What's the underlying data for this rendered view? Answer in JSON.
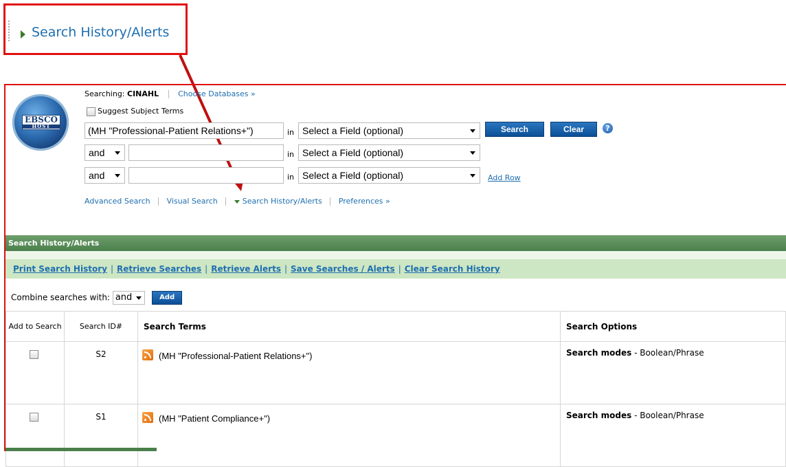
{
  "callout": {
    "label": "Search History/Alerts"
  },
  "logo": {
    "line1": "EBSCO",
    "line2": "HOST"
  },
  "header": {
    "searching_label": "Searching:",
    "database": "CINAHL",
    "choose_db": "Choose Databases »",
    "suggest_terms": "Suggest Subject Terms"
  },
  "search": {
    "row1_value": "(MH \"Professional-Patient Relations+\")",
    "row2_value": "",
    "row3_value": "",
    "in_label": "in",
    "field_placeholder": "Select a Field (optional)",
    "bool_op": "and",
    "search_btn": "Search",
    "clear_btn": "Clear",
    "help": "?",
    "add_row": "Add Row"
  },
  "nav": {
    "advanced": "Advanced Search",
    "visual": "Visual Search",
    "history": "Search History/Alerts",
    "preferences": "Preferences »"
  },
  "history": {
    "title": "Search History/Alerts",
    "links": [
      "Print Search History",
      "Retrieve Searches",
      "Retrieve Alerts",
      "Save Searches / Alerts",
      "Clear Search History"
    ],
    "combine_label": "Combine searches with:",
    "combine_op": "and",
    "add_btn": "Add",
    "columns": {
      "add": "Add to Search",
      "id": "Search ID#",
      "terms": "Search Terms",
      "options": "Search Options"
    },
    "rows": [
      {
        "id": "S2",
        "terms": "(MH \"Professional-Patient Relations+\")",
        "mode_label": "Search modes",
        "mode_value": " - Boolean/Phrase"
      },
      {
        "id": "S1",
        "terms": "(MH \"Patient Compliance+\")",
        "mode_label": "Search modes",
        "mode_value": " - Boolean/Phrase"
      }
    ]
  },
  "colors": {
    "annotation_red": "#e01010",
    "link_blue": "#1f6fb0",
    "panel_green": "#4a7f4a",
    "links_bg": "#cde6c3"
  }
}
